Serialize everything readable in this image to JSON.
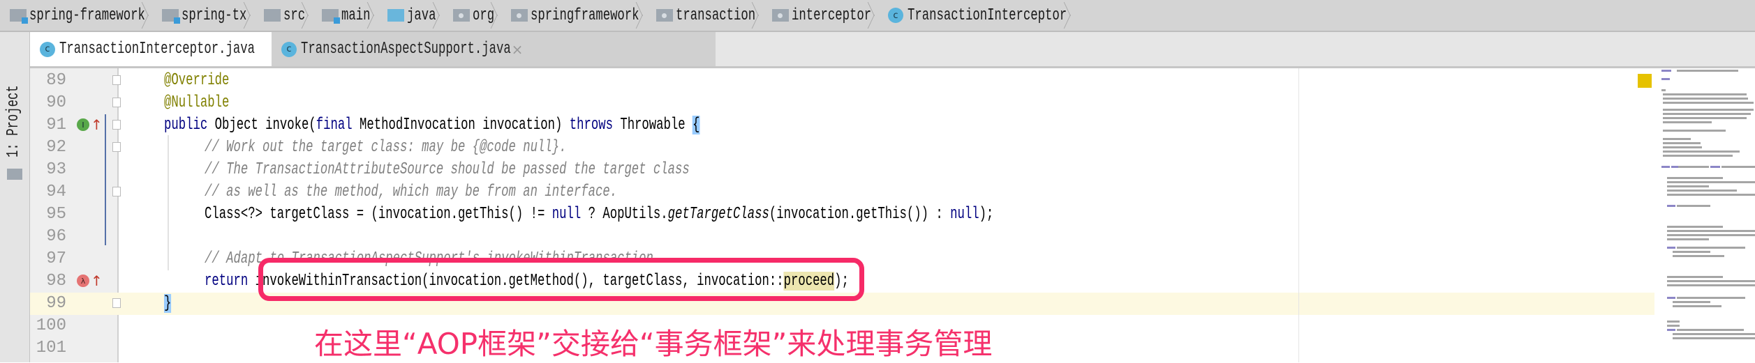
{
  "breadcrumbs": [
    {
      "label": "spring-framework",
      "icon": "module-folder-icon"
    },
    {
      "label": "spring-tx",
      "icon": "module-folder-icon"
    },
    {
      "label": "src",
      "icon": "folder-icon"
    },
    {
      "label": "main",
      "icon": "module-folder-icon"
    },
    {
      "label": "java",
      "icon": "source-folder-icon"
    },
    {
      "label": "org",
      "icon": "package-icon"
    },
    {
      "label": "springframework",
      "icon": "package-icon"
    },
    {
      "label": "transaction",
      "icon": "package-icon"
    },
    {
      "label": "interceptor",
      "icon": "package-icon"
    },
    {
      "label": "TransactionInterceptor",
      "icon": "class-icon"
    }
  ],
  "tool_window": {
    "label": "1: Project"
  },
  "tabs": [
    {
      "label": "TransactionInterceptor.java",
      "icon_letter": "c",
      "active": true,
      "close": "×"
    },
    {
      "label": "TransactionAspectSupport.java",
      "icon_letter": "c",
      "active": false,
      "close": "×"
    }
  ],
  "editor": {
    "current_line": 99,
    "lines": [
      {
        "num": "89",
        "indent": 1,
        "tokens": [
          {
            "text": "@Override",
            "style": "ann"
          }
        ]
      },
      {
        "num": "90",
        "indent": 1,
        "tokens": [
          {
            "text": "@Nullable",
            "style": "ann"
          }
        ]
      },
      {
        "num": "91",
        "indent": 1,
        "gutter_icon": "implements-method-icon",
        "tokens": [
          {
            "text": "public",
            "style": "kw"
          },
          {
            "text": " Object invoke(",
            "style": ""
          },
          {
            "text": "final",
            "style": "kw"
          },
          {
            "text": " MethodInvocation invocation) ",
            "style": ""
          },
          {
            "text": "throws",
            "style": "kw"
          },
          {
            "text": " Throwable ",
            "style": ""
          },
          {
            "text": "{",
            "style": "brace"
          }
        ]
      },
      {
        "num": "92",
        "indent": 2,
        "tokens": [
          {
            "text": "// Work out the target class: may be {@code null}.",
            "style": "cm"
          }
        ]
      },
      {
        "num": "93",
        "indent": 2,
        "tokens": [
          {
            "text": "// The TransactionAttributeSource should be passed the target class",
            "style": "cm"
          }
        ]
      },
      {
        "num": "94",
        "indent": 2,
        "tokens": [
          {
            "text": "// as well as the method, which may be from an interface.",
            "style": "cm"
          }
        ]
      },
      {
        "num": "95",
        "indent": 2,
        "tokens": [
          {
            "text": "Class<?> targetClass = (invocation.getThis() != ",
            "style": ""
          },
          {
            "text": "null",
            "style": "kw"
          },
          {
            "text": " ? AopUtils.",
            "style": ""
          },
          {
            "text": "getTargetClass",
            "style": "it"
          },
          {
            "text": "(invocation.getThis()) : ",
            "style": ""
          },
          {
            "text": "null",
            "style": "kw"
          },
          {
            "text": ");",
            "style": ""
          }
        ]
      },
      {
        "num": "96",
        "indent": 2,
        "tokens": []
      },
      {
        "num": "97",
        "indent": 2,
        "tokens": [
          {
            "text": "// Adapt to TransactionAspectSupport's invokeWithinTransaction...",
            "style": "cm"
          }
        ]
      },
      {
        "num": "98",
        "indent": 2,
        "gutter_icon": "lambda-icon",
        "tokens": [
          {
            "text": "return",
            "style": "kw"
          },
          {
            "text": " invokeWithinTransaction(invocation.getMethod(), targetClass, invocation::",
            "style": ""
          },
          {
            "text": "proceed",
            "style": "hlw"
          },
          {
            "text": ");",
            "style": ""
          }
        ]
      },
      {
        "num": "99",
        "indent": 1,
        "tokens": [
          {
            "text": "}",
            "style": "brace"
          }
        ]
      },
      {
        "num": "100",
        "indent": 1,
        "tokens": []
      },
      {
        "num": "101",
        "indent": 1,
        "tokens": []
      }
    ]
  },
  "annotation": {
    "text": "在这里“AOP框架”交接给“事务框架”来处理事务管理",
    "color": "#f5306b"
  },
  "colors": {
    "keyword": "#000080",
    "annotation": "#808000",
    "comment": "#808080",
    "current_line": "#fdf9e1",
    "callout": "#f62a67"
  }
}
